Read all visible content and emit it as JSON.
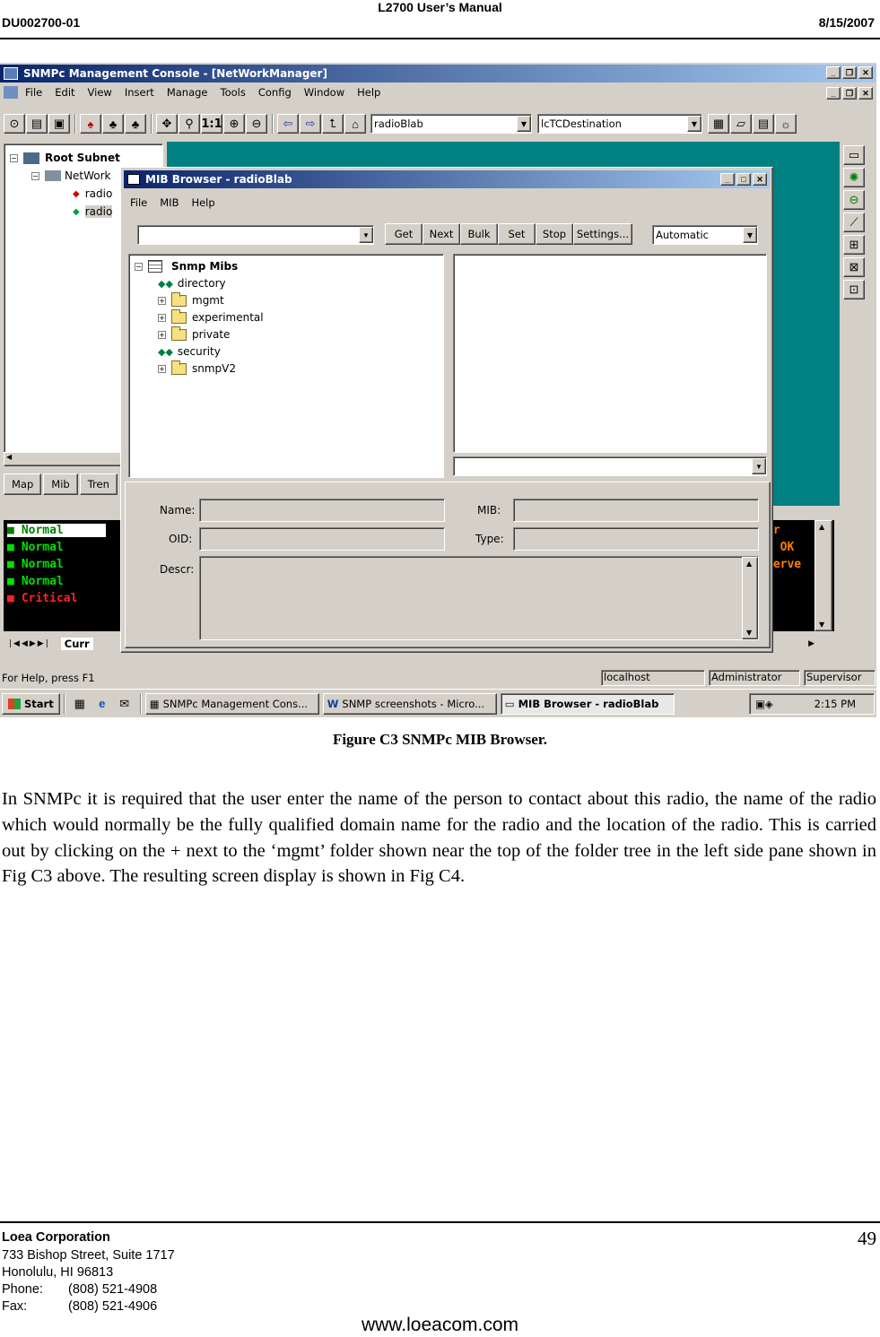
{
  "header": {
    "title": "L2700 User’s Manual",
    "doc_id": "DU002700-01",
    "date": "8/15/2007"
  },
  "console": {
    "title": "SNMPc Management Console - [NetWorkManager]",
    "menu": [
      "File",
      "Edit",
      "View",
      "Insert",
      "Manage",
      "Tools",
      "Config",
      "Window",
      "Help"
    ],
    "toolbar_combo1": "radioBlab",
    "toolbar_combo2": "lcTCDestination",
    "zoom_label": "1:1",
    "tree": {
      "root": "Root Subnet",
      "net": "NetWork",
      "item1": "radio",
      "item2": "radio"
    },
    "left_tabs": [
      "Map",
      "Mib",
      "Tren"
    ],
    "events": {
      "statuses": [
        "Normal",
        "Normal",
        "Normal",
        "Normal",
        "Critical"
      ],
      "right_col": [
        "er",
        "n OK",
        "Serve"
      ],
      "tab": "Curr"
    },
    "status_bar": {
      "help": "For Help, press F1",
      "host": "localhost",
      "user": "Administrator",
      "role": "Supervisor"
    }
  },
  "taskbar": {
    "start": "Start",
    "tasks": [
      "SNMPc Management Cons...",
      "SNMP screenshots - Micro...",
      "MIB Browser - radioBlab"
    ],
    "clock": "2:15 PM"
  },
  "mib": {
    "title": "MIB Browser - radioBlab",
    "menu": [
      "File",
      "MIB",
      "Help"
    ],
    "buttons": [
      "Get",
      "Next",
      "Bulk",
      "Set",
      "Stop",
      "Settings..."
    ],
    "mode": "Automatic",
    "tree_root": "Snmp Mibs",
    "tree_items": [
      {
        "label": "directory",
        "type": "leaf"
      },
      {
        "label": "mgmt",
        "type": "folder"
      },
      {
        "label": "experimental",
        "type": "folder"
      },
      {
        "label": "private",
        "type": "folder"
      },
      {
        "label": "security",
        "type": "leaf"
      },
      {
        "label": "snmpV2",
        "type": "folder"
      }
    ],
    "fields": {
      "name": "Name:",
      "oid": "OID:",
      "descr": "Descr:",
      "mib": "MIB:",
      "type": "Type:"
    }
  },
  "caption": "Figure C3 SNMPc MIB Browser.",
  "body": "In SNMPc it is required that the user enter the name of the person to contact about this radio, the name of the radio which would normally be the fully qualified domain name for the radio and the location of the radio. This is carried out by clicking on the + next to the ‘mgmt’ folder shown near the top of the folder tree in the left side pane shown in Fig C3 above. The resulting screen display is shown in Fig C4.",
  "footer": {
    "company": "Loea Corporation",
    "address1": "733 Bishop Street, Suite 1717",
    "address2": "Honolulu, HI  96813",
    "phone_label": "Phone:",
    "phone": "(808) 521-4908",
    "fax_label": "Fax:",
    "fax": "(808) 521-4906",
    "page": "49",
    "website": "www.loeacom.com"
  }
}
